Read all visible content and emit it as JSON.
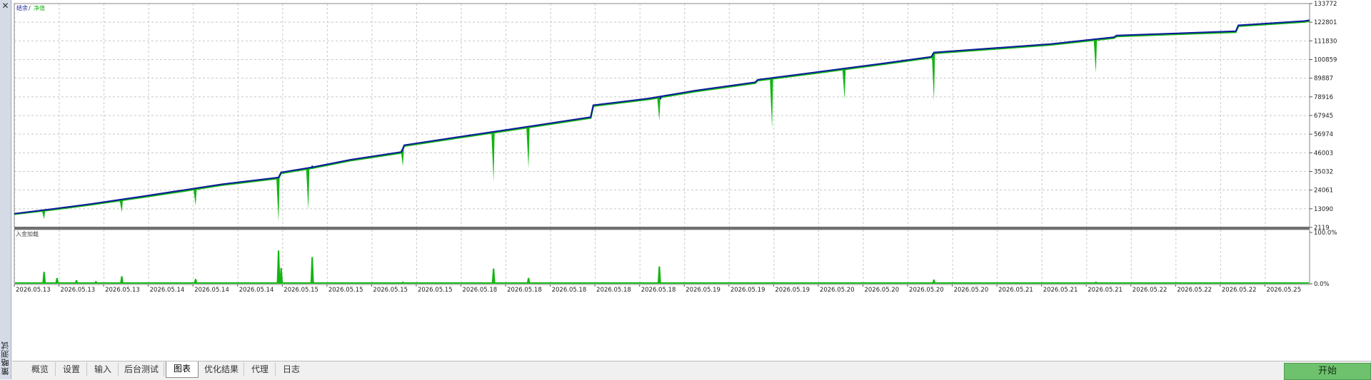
{
  "window": {
    "close_glyph": "✕",
    "vertical_title": "策略测试"
  },
  "tabs": [
    {
      "label": "概览"
    },
    {
      "label": "设置"
    },
    {
      "label": "输入"
    },
    {
      "label": "后台测试"
    },
    {
      "label": "图表",
      "active": true
    },
    {
      "label": "优化结果"
    },
    {
      "label": "代理"
    },
    {
      "label": "日志"
    }
  ],
  "start_button": "开始",
  "colors": {
    "balance": "#0a1a9c",
    "equity": "#12b512",
    "load": "#12b512",
    "grid": "#c8c8c8",
    "separator": "#707070"
  },
  "chart_data": [
    {
      "type": "line",
      "legend": {
        "balance": "结余",
        "separator": "/",
        "equity": "净值",
        "placement": "top-left"
      },
      "x_tick_labels": [
        "2026.05.13",
        "2026.05.13",
        "2026.05.13",
        "2026.05.14",
        "2026.05.14",
        "2026.05.14",
        "2026.05.15",
        "2026.05.15",
        "2026.05.15",
        "2026.05.15",
        "2026.05.18",
        "2026.05.18",
        "2026.05.18",
        "2026.05.18",
        "2026.05.18",
        "2026.05.19",
        "2026.05.19",
        "2026.05.19",
        "2026.05.20",
        "2026.05.20",
        "2026.05.20",
        "2026.05.20",
        "2026.05.21",
        "2026.05.21",
        "2026.05.21",
        "2026.05.22",
        "2026.05.22",
        "2026.05.22",
        "2026.05.25"
      ],
      "y_tick_labels": [
        "133772",
        "122801",
        "111830",
        "100859",
        "89887",
        "78916",
        "67945",
        "56974",
        "46003",
        "35032",
        "24061",
        "13090",
        "2119"
      ],
      "ylim": [
        2119,
        133772
      ],
      "grid": true,
      "x": [
        0,
        3,
        6,
        10,
        13,
        16,
        20.4,
        20.6,
        23,
        26,
        29.9,
        30.1,
        34,
        38,
        44.5,
        44.7,
        49,
        52.5,
        57.2,
        57.4,
        62,
        67,
        70.8,
        71,
        80,
        84.9,
        85.1,
        94.3,
        94.5,
        99.6,
        100
      ],
      "series": [
        {
          "name": "结余",
          "values": [
            10200,
            13000,
            16000,
            20500,
            24000,
            27500,
            31500,
            34500,
            37500,
            42000,
            46500,
            50500,
            55000,
            59500,
            67000,
            74000,
            78000,
            82500,
            87500,
            89000,
            93500,
            98500,
            102500,
            105000,
            110000,
            114000,
            115000,
            117500,
            121000,
            123500,
            124000
          ]
        },
        {
          "name": "净值",
          "values": [
            10000,
            12600,
            15600,
            20000,
            23400,
            27000,
            31000,
            34000,
            37000,
            41500,
            46000,
            50000,
            54500,
            59000,
            66500,
            73500,
            77500,
            82000,
            87000,
            88500,
            93000,
            98000,
            102000,
            104500,
            109500,
            113500,
            114500,
            117000,
            120500,
            123000,
            123500
          ]
        }
      ],
      "equity_dips": [
        {
          "x": 2.3,
          "value": 7000
        },
        {
          "x": 8.3,
          "value": 11000
        },
        {
          "x": 14,
          "value": 15000
        },
        {
          "x": 20.4,
          "value": 5500
        },
        {
          "x": 22.7,
          "value": 12500
        },
        {
          "x": 30,
          "value": 38000
        },
        {
          "x": 37,
          "value": 29000
        },
        {
          "x": 39.7,
          "value": 37000
        },
        {
          "x": 49.8,
          "value": 65000
        },
        {
          "x": 58.5,
          "value": 60500
        },
        {
          "x": 64.1,
          "value": 77500
        },
        {
          "x": 71,
          "value": 76500
        },
        {
          "x": 83.5,
          "value": 93000
        }
      ],
      "balance_spikes": [
        {
          "x": 23,
          "value": 38500
        },
        {
          "x": 49.9,
          "value": 77500
        }
      ]
    },
    {
      "type": "area",
      "title": "入金加载",
      "y_tick_labels": [
        "100.0%",
        "0.0%"
      ],
      "ylim": [
        0,
        100
      ],
      "spikes": [
        {
          "x": 2.3,
          "value": 23
        },
        {
          "x": 3.3,
          "value": 12
        },
        {
          "x": 4.8,
          "value": 8
        },
        {
          "x": 6.3,
          "value": 6
        },
        {
          "x": 8.3,
          "value": 15
        },
        {
          "x": 14,
          "value": 10
        },
        {
          "x": 20.4,
          "value": 62
        },
        {
          "x": 20.6,
          "value": 30
        },
        {
          "x": 23,
          "value": 50
        },
        {
          "x": 30,
          "value": 5
        },
        {
          "x": 37,
          "value": 29
        },
        {
          "x": 39.7,
          "value": 12
        },
        {
          "x": 49.8,
          "value": 33
        },
        {
          "x": 58.5,
          "value": 4
        },
        {
          "x": 71,
          "value": 9
        },
        {
          "x": 83.5,
          "value": 5
        }
      ]
    }
  ]
}
